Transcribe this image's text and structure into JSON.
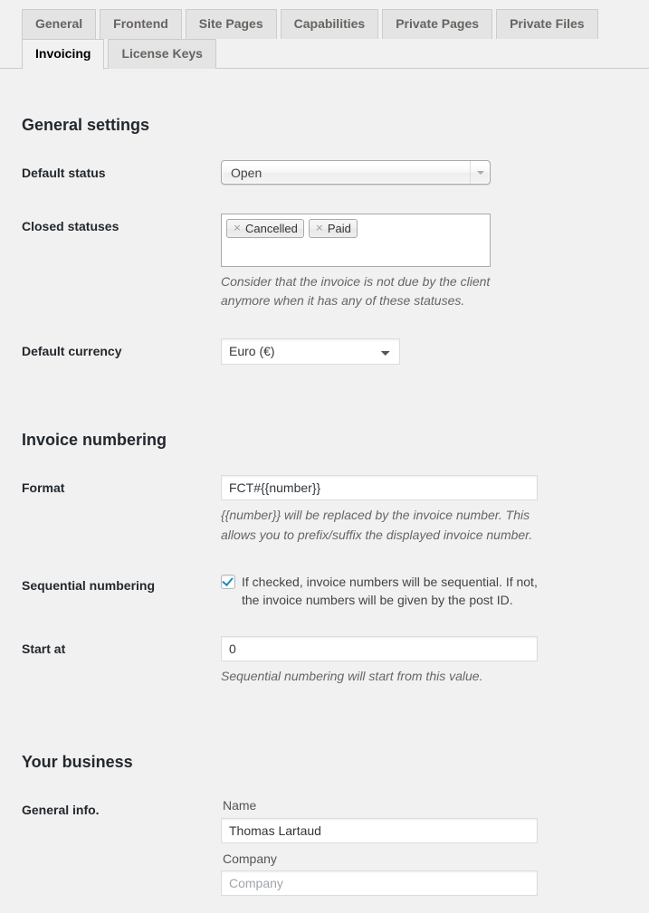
{
  "tabs": {
    "row1": [
      {
        "label": "General",
        "active": false
      },
      {
        "label": "Frontend",
        "active": false
      },
      {
        "label": "Site Pages",
        "active": false
      },
      {
        "label": "Capabilities",
        "active": false
      },
      {
        "label": "Private Pages",
        "active": false
      },
      {
        "label": "Private Files",
        "active": false
      }
    ],
    "row2": [
      {
        "label": "Invoicing",
        "active": true
      },
      {
        "label": "License Keys",
        "active": false
      }
    ]
  },
  "sections": {
    "general_settings": {
      "title": "General settings",
      "default_status": {
        "label": "Default status",
        "value": "Open"
      },
      "closed_statuses": {
        "label": "Closed statuses",
        "tags": [
          "Cancelled",
          "Paid"
        ],
        "remove_icon": "×",
        "description": "Consider that the invoice is not due by the client anymore when it has any of these statuses."
      },
      "default_currency": {
        "label": "Default currency",
        "value": "Euro (€)",
        "options": [
          "Euro (€)"
        ]
      }
    },
    "invoice_numbering": {
      "title": "Invoice numbering",
      "format": {
        "label": "Format",
        "value": "FCT#{{number}}",
        "description": "{{number}} will be replaced by the invoice number. This allows you to prefix/suffix the displayed invoice number."
      },
      "sequential_numbering": {
        "label": "Sequential numbering",
        "checked": true,
        "checkbox_label": "If checked, invoice numbers will be sequential. If not, the invoice numbers will be given by the post ID."
      },
      "start_at": {
        "label": "Start at",
        "value": "0",
        "description": "Sequential numbering will start from this value."
      }
    },
    "your_business": {
      "title": "Your business",
      "general_info": {
        "label": "General info.",
        "name": {
          "label": "Name",
          "value": "Thomas Lartaud",
          "placeholder": "Name"
        },
        "company": {
          "label": "Company",
          "value": "",
          "placeholder": "Company"
        }
      }
    }
  },
  "colors": {
    "page_background": "#f1f1f1",
    "tab_inactive_background": "#e4e4e4",
    "tab_active_background": "#f1f1f1",
    "tab_border": "#cccccc",
    "label_text": "#23282d",
    "description_text": "#666666",
    "checkbox_accent": "#1e8cbe",
    "placeholder_text": "#a0a5aa"
  }
}
